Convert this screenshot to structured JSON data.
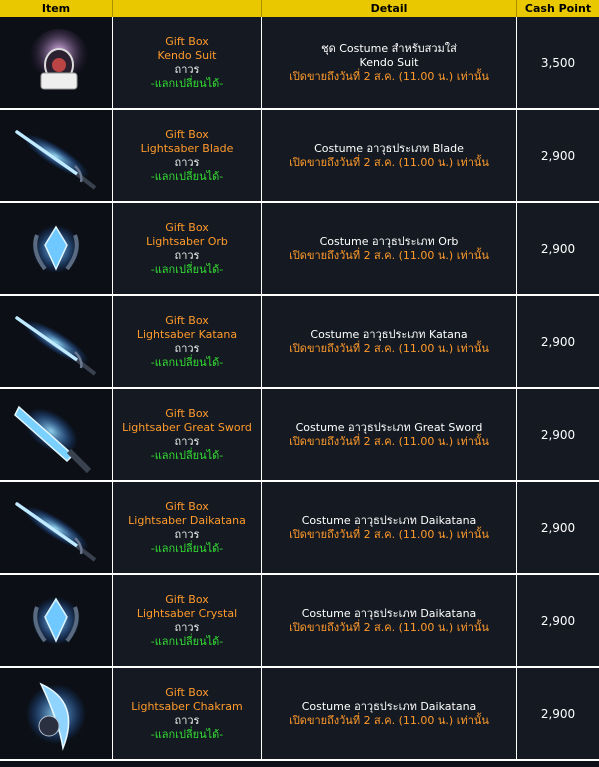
{
  "header": {
    "item": "Item",
    "detail": "Detail",
    "cash": "Cash Point"
  },
  "rows": [
    {
      "icon": "kendo-suit-icon",
      "box": "Gift Box",
      "name": "Kendo Suit",
      "dur": "ถาวร",
      "trade": "-แลกเปลี่ยนได้-",
      "detail1": "ชุด Costume สำหรับสวมใส่",
      "detail2": "Kendo Suit",
      "detail3": "เปิดขายถึงวันที่ 2 ส.ค. (11.00 น.) เท่านั้น",
      "price": "3,500"
    },
    {
      "icon": "lightsaber-blade-icon",
      "box": "Gift Box",
      "name": "Lightsaber Blade",
      "dur": "ถาวร",
      "trade": "-แลกเปลี่ยนได้-",
      "detail1": "Costume อาวุธประเภท Blade",
      "detail2": "",
      "detail3": "เปิดขายถึงวันที่ 2 ส.ค. (11.00 น.) เท่านั้น",
      "price": "2,900"
    },
    {
      "icon": "lightsaber-orb-icon",
      "box": "Gift Box",
      "name": "Lightsaber Orb",
      "dur": "ถาวร",
      "trade": "-แลกเปลี่ยนได้-",
      "detail1": "Costume อาวุธประเภท Orb",
      "detail2": "",
      "detail3": "เปิดขายถึงวันที่ 2 ส.ค. (11.00 น.) เท่านั้น",
      "price": "2,900"
    },
    {
      "icon": "lightsaber-katana-icon",
      "box": "Gift Box",
      "name": "Lightsaber Katana",
      "dur": "ถาวร",
      "trade": "-แลกเปลี่ยนได้-",
      "detail1": "Costume อาวุธประเภท Katana",
      "detail2": "",
      "detail3": "เปิดขายถึงวันที่ 2 ส.ค. (11.00 น.) เท่านั้น",
      "price": "2,900"
    },
    {
      "icon": "lightsaber-great-sword-icon",
      "box": "Gift Box",
      "name": "Lightsaber Great Sword",
      "dur": "ถาวร",
      "trade": "-แลกเปลี่ยนได้-",
      "detail1": "Costume อาวุธประเภท Great Sword",
      "detail2": "",
      "detail3": "เปิดขายถึงวันที่ 2 ส.ค. (11.00 น.) เท่านั้น",
      "price": "2,900"
    },
    {
      "icon": "lightsaber-daikatana-icon",
      "box": "Gift Box",
      "name": "Lightsaber Daikatana",
      "dur": "ถาวร",
      "trade": "-แลกเปลี่ยนได้-",
      "detail1": "Costume อาวุธประเภท Daikatana",
      "detail2": "",
      "detail3": "เปิดขายถึงวันที่ 2 ส.ค. (11.00 น.) เท่านั้น",
      "price": "2,900"
    },
    {
      "icon": "lightsaber-crystal-icon",
      "box": "Gift Box",
      "name": "Lightsaber Crystal",
      "dur": "ถาวร",
      "trade": "-แลกเปลี่ยนได้-",
      "detail1": "Costume อาวุธประเภท Daikatana",
      "detail2": "",
      "detail3": "เปิดขายถึงวันที่ 2 ส.ค. (11.00 น.) เท่านั้น",
      "price": "2,900"
    },
    {
      "icon": "lightsaber-chakram-icon",
      "box": "Gift Box",
      "name": "Lightsaber Chakram",
      "dur": "ถาวร",
      "trade": "-แลกเปลี่ยนได้-",
      "detail1": "Costume อาวุธประเภท Daikatana",
      "detail2": "",
      "detail3": "เปิดขายถึงวันที่ 2 ส.ค. (11.00 น.) เท่านั้น",
      "price": "2,900"
    }
  ]
}
